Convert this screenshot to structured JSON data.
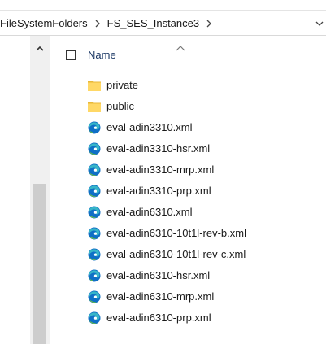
{
  "address_bar": {
    "breadcrumbs": [
      "FileSystemFolders",
      "FS_SES_Instance3"
    ],
    "separator_icon": "chevron-right-icon",
    "dropdown_icon": "chevron-down-icon"
  },
  "nav_pane": {
    "scroll_up_icon": "chevron-up-icon"
  },
  "file_list": {
    "columns": {
      "name": "Name"
    },
    "sort": {
      "column": "Name",
      "direction": "ascending",
      "icon": "sort-ascending-icon"
    },
    "items": [
      {
        "name": "private",
        "type": "folder",
        "icon": "folder-icon"
      },
      {
        "name": "public",
        "type": "folder",
        "icon": "folder-icon"
      },
      {
        "name": "eval-adin3310.xml",
        "type": "file",
        "icon": "edge-icon"
      },
      {
        "name": "eval-adin3310-hsr.xml",
        "type": "file",
        "icon": "edge-icon"
      },
      {
        "name": "eval-adin3310-mrp.xml",
        "type": "file",
        "icon": "edge-icon"
      },
      {
        "name": "eval-adin3310-prp.xml",
        "type": "file",
        "icon": "edge-icon"
      },
      {
        "name": "eval-adin6310.xml",
        "type": "file",
        "icon": "edge-icon"
      },
      {
        "name": "eval-adin6310-10t1l-rev-b.xml",
        "type": "file",
        "icon": "edge-icon"
      },
      {
        "name": "eval-adin6310-10t1l-rev-c.xml",
        "type": "file",
        "icon": "edge-icon"
      },
      {
        "name": "eval-adin6310-hsr.xml",
        "type": "file",
        "icon": "edge-icon"
      },
      {
        "name": "eval-adin6310-mrp.xml",
        "type": "file",
        "icon": "edge-icon"
      },
      {
        "name": "eval-adin6310-prp.xml",
        "type": "file",
        "icon": "edge-icon"
      }
    ]
  },
  "colors": {
    "folder": "#ffd866",
    "folder_shade": "#e8b93a",
    "edge_blue": "#0f6fc6",
    "edge_teal": "#37b5c8",
    "edge_green": "#6fc33a",
    "scrollbar_track": "#f0f0f0",
    "scrollbar_thumb": "#cdcdcd"
  }
}
